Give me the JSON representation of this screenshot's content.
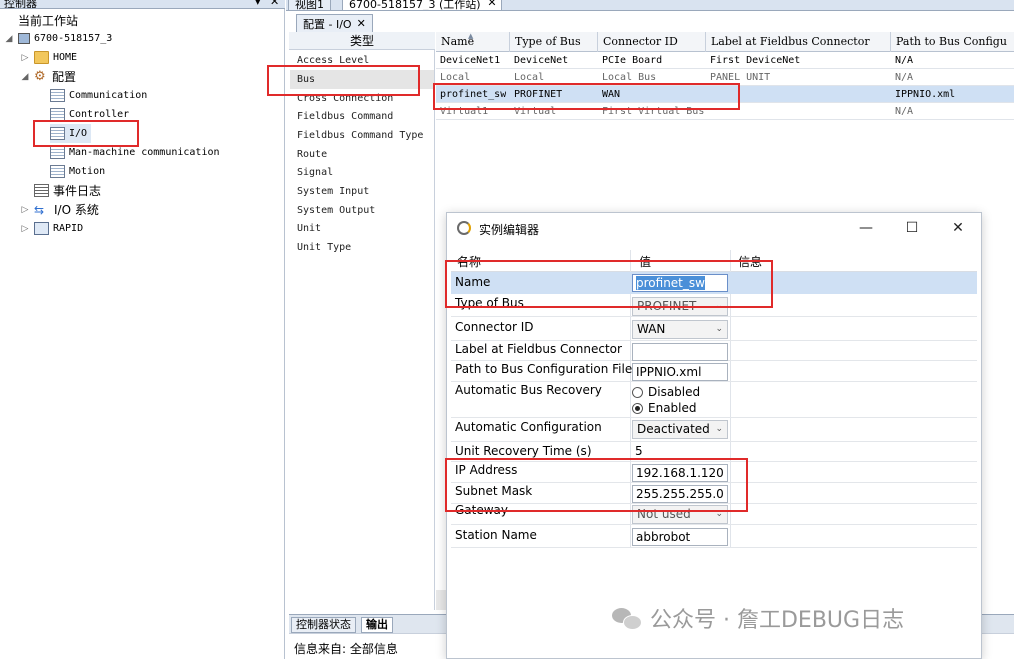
{
  "left_panel": {
    "title": "控制器",
    "pin": "▾",
    "close": "✕",
    "current_station": "当前工作站",
    "controller": "6700-518157_3",
    "home": "HOME",
    "config": "配置",
    "config_items": [
      "Communication",
      "Controller",
      "I/O",
      "Man-machine communication",
      "Motion"
    ],
    "event_log": "事件日志",
    "io_system": "I/O 系统",
    "rapid": "RAPID"
  },
  "tabs": {
    "view1": "视图1",
    "station_tab": "6700-518157_3 (工作站)",
    "close": "✕",
    "sub_tab": "配置 - I/O",
    "sub_close": "✕"
  },
  "type_list": {
    "header": "类型",
    "items": [
      "Access Level",
      "Bus",
      "Cross Connection",
      "Fieldbus Command",
      "Fieldbus Command Type",
      "Route",
      "Signal",
      "System Input",
      "System Output",
      "Unit",
      "Unit Type"
    ]
  },
  "grid": {
    "headers": [
      "Name",
      "Type of Bus",
      "Connector ID",
      "Label at Fieldbus Connector",
      "Path to Bus Configu"
    ],
    "rows": [
      [
        "DeviceNet1",
        "DeviceNet",
        "PCIe Board",
        "First DeviceNet",
        "N/A"
      ],
      [
        "Local",
        "Local",
        "Local Bus",
        "PANEL UNIT",
        "N/A"
      ],
      [
        "profinet_sw",
        "PROFINET",
        "WAN",
        "",
        "IPPNIO.xml"
      ],
      [
        "Virtual1",
        "Virtual",
        "First Virtual Bus",
        "",
        "N/A"
      ]
    ]
  },
  "dialog": {
    "title": "实例编辑器",
    "btn_min": "—",
    "btn_max": "☐",
    "btn_close": "✕",
    "col_name": "名称",
    "col_value": "值",
    "col_info": "信息",
    "name_label": "Name",
    "name_value": "profinet_sw",
    "type_of_bus_label": "Type of Bus",
    "type_of_bus_value": "PROFINET",
    "connector_id_label": "Connector ID",
    "connector_id_value": "WAN",
    "label_fieldbus_label": "Label at Fieldbus Connector",
    "label_fieldbus_value": "",
    "path_label": "Path to Bus Configuration File",
    "path_value": "IPPNIO.xml",
    "auto_recovery_label": "Automatic Bus Recovery",
    "auto_recovery_disabled": "Disabled",
    "auto_recovery_enabled": "Enabled",
    "auto_config_label": "Automatic Configuration",
    "auto_config_value": "Deactivated",
    "unit_recovery_label": "Unit Recovery Time (s)",
    "unit_recovery_value": "5",
    "ip_label": "IP Address",
    "ip_value": "192.168.1.120",
    "subnet_label": "Subnet Mask",
    "subnet_value": "255.255.255.0",
    "gateway_label": "Gateway",
    "gateway_value": "Not used",
    "station_label": "Station Name",
    "station_value": "abbrobot",
    "chev": "⌄"
  },
  "bottom": {
    "tab_status": "控制器状态",
    "tab_output": "输出",
    "info": "信息来自: 全部信息"
  },
  "watermark": {
    "text": "公众号 · 詹工DEBUG日志"
  },
  "colors": {
    "highlight_red": "#e02a2a",
    "selection_blue": "#cfe0f4"
  }
}
